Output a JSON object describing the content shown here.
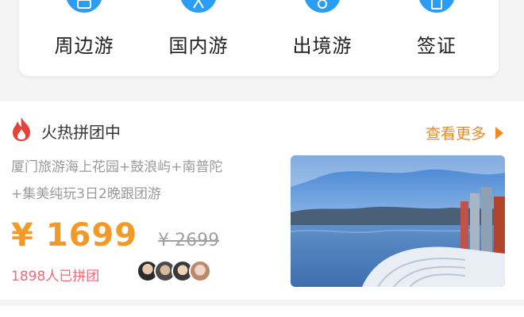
{
  "categories": [
    {
      "label": "周边游",
      "icon": "nearby-travel-icon"
    },
    {
      "label": "国内游",
      "icon": "domestic-travel-icon"
    },
    {
      "label": "出境游",
      "icon": "outbound-travel-icon"
    },
    {
      "label": "签证",
      "icon": "visa-icon"
    }
  ],
  "hot_group": {
    "title": "火热拼团中",
    "title_icon": "flame-icon",
    "more_label": "查看更多",
    "product": {
      "desc_line1": "厦门旅游海上花园+鼓浪屿+南普陀",
      "desc_line2": "+集美纯玩3日2晚跟团游",
      "price": "¥ 1699",
      "original_price": "¥ 2699",
      "joined_text": "1898人已拼团"
    }
  },
  "colors": {
    "accent_blue": "#2a9df4",
    "price_orange": "#f39a26",
    "more_orange": "#f08a24",
    "joined_pink": "#f06a7a",
    "flame_red": "#e8413a"
  }
}
